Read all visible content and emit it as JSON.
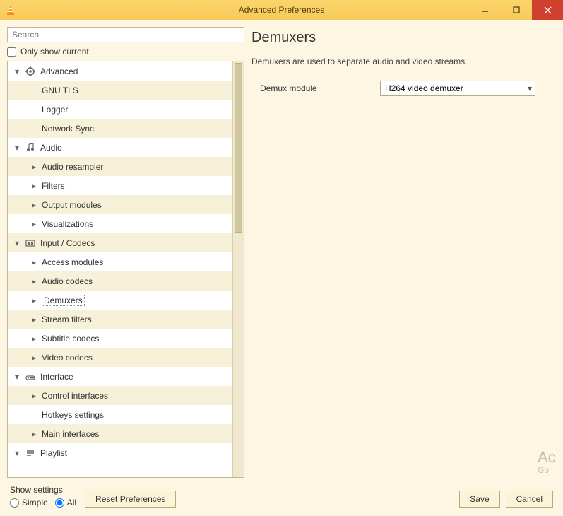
{
  "window": {
    "title": "Advanced Preferences"
  },
  "search": {
    "placeholder": "Search"
  },
  "only_current": "Only show current",
  "tree": {
    "advanced": {
      "label": "Advanced",
      "children": {
        "gnu_tls": "GNU TLS",
        "logger": "Logger",
        "network_sync": "Network Sync"
      }
    },
    "audio": {
      "label": "Audio",
      "children": {
        "audio_resampler": "Audio resampler",
        "filters": "Filters",
        "output_modules": "Output modules",
        "visualizations": "Visualizations"
      }
    },
    "input_codecs": {
      "label": "Input / Codecs",
      "children": {
        "access_modules": "Access modules",
        "audio_codecs": "Audio codecs",
        "demuxers": "Demuxers",
        "stream_filters": "Stream filters",
        "subtitle_codecs": "Subtitle codecs",
        "video_codecs": "Video codecs"
      }
    },
    "interface": {
      "label": "Interface",
      "children": {
        "control_interfaces": "Control interfaces",
        "hotkeys_settings": "Hotkeys settings",
        "main_interfaces": "Main interfaces"
      }
    },
    "playlist": {
      "label": "Playlist"
    }
  },
  "right": {
    "title": "Demuxers",
    "desc": "Demuxers are used to separate audio and video streams.",
    "field_label": "Demux module",
    "field_value": "H264 video demuxer"
  },
  "bottom": {
    "show_settings": "Show settings",
    "simple": "Simple",
    "all": "All",
    "reset": "Reset Preferences",
    "save": "Save",
    "cancel": "Cancel"
  },
  "watermark": {
    "l1": "Ac",
    "l2": "Go"
  }
}
